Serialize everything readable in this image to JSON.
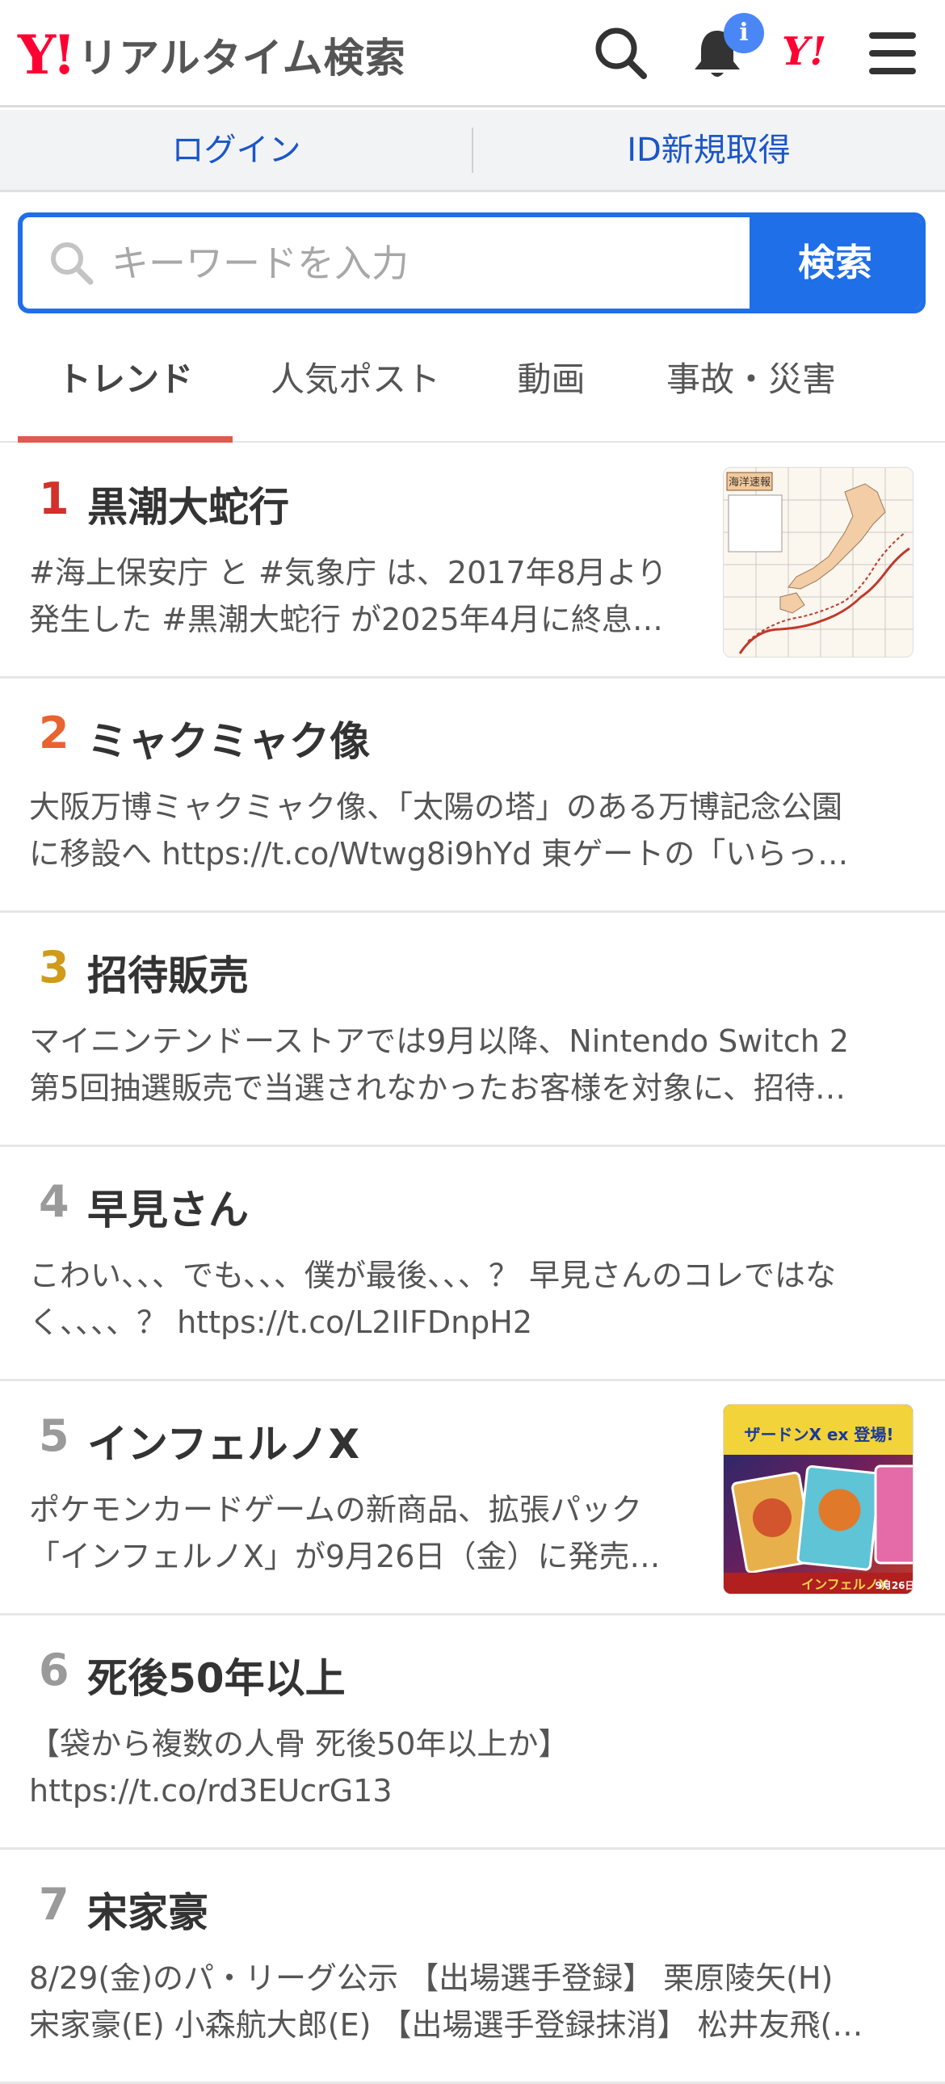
{
  "header": {
    "logo_mark": "Y!",
    "logo_text": "リアルタイム検索",
    "badge": "i",
    "yjp_mark": "Y!"
  },
  "account": {
    "login": "ログイン",
    "signup": "ID新規取得"
  },
  "search": {
    "placeholder": "キーワードを入力",
    "button": "検索"
  },
  "tabs": [
    {
      "label": "トレンド"
    },
    {
      "label": "人気ポスト"
    },
    {
      "label": "動画"
    },
    {
      "label": "事故・災害"
    }
  ],
  "trends": [
    {
      "rank": "1",
      "title": "黒潮大蛇行",
      "desc_line1": "#海上保安庁 と #気象庁 は、2017年8月より",
      "desc_line2": "発生した #黒潮大蛇行 が2025年4月に終息…",
      "rank_color": "#d3312b"
    },
    {
      "rank": "2",
      "title": "ミャクミャク像",
      "desc_line1": "大阪万博ミャクミャク像、「太陽の塔」のある万博記念公園",
      "desc_line2": "に移設へ https://t.co/Wtwg8i9hYd 東ゲートの「いらっ…",
      "rank_color": "#e8632f"
    },
    {
      "rank": "3",
      "title": "招待販売",
      "desc_line1": "マイニンテンドーストアでは9月以降、Nintendo Switch 2",
      "desc_line2": "第5回抽選販売で当選されなかったお客様を対象に、招待…",
      "rank_color": "#d09a1a"
    },
    {
      "rank": "4",
      "title": "早見さん",
      "desc_line1": "こわい、、、でも、、、僕が最後、、、？ 早見さんのコレではな",
      "desc_line2": "く、、、、？ https://t.co/L2IIFDnpH2",
      "rank_color": "#9a9a9a"
    },
    {
      "rank": "5",
      "title": "インフェルノX",
      "desc_line1": "ポケモンカードゲームの新商品、拡張パック",
      "desc_line2": "「インフェルノX」が9月26日（金）に発売…",
      "rank_color": "#9a9a9a"
    },
    {
      "rank": "6",
      "title": "死後50年以上",
      "desc_line1": "【袋から複数の人骨 死後50年以上か】",
      "desc_line2": "https://t.co/rd3EUcrG13",
      "rank_color": "#9a9a9a"
    },
    {
      "rank": "7",
      "title": "宋家豪",
      "desc_line1": "8/29(金)のパ・リーグ公示 【出場選手登録】 栗原陵矢(H)",
      "desc_line2": "宋家豪(E) 小森航大郎(E) 【出場選手登録抹消】 松井友飛(…",
      "rank_color": "#9a9a9a"
    }
  ],
  "thumb_texts": {
    "map_title": "海洋速報",
    "card_banner": "ザードンX ex 登場!",
    "card_logo": "インフェルノX",
    "card_date": "9月26日"
  }
}
